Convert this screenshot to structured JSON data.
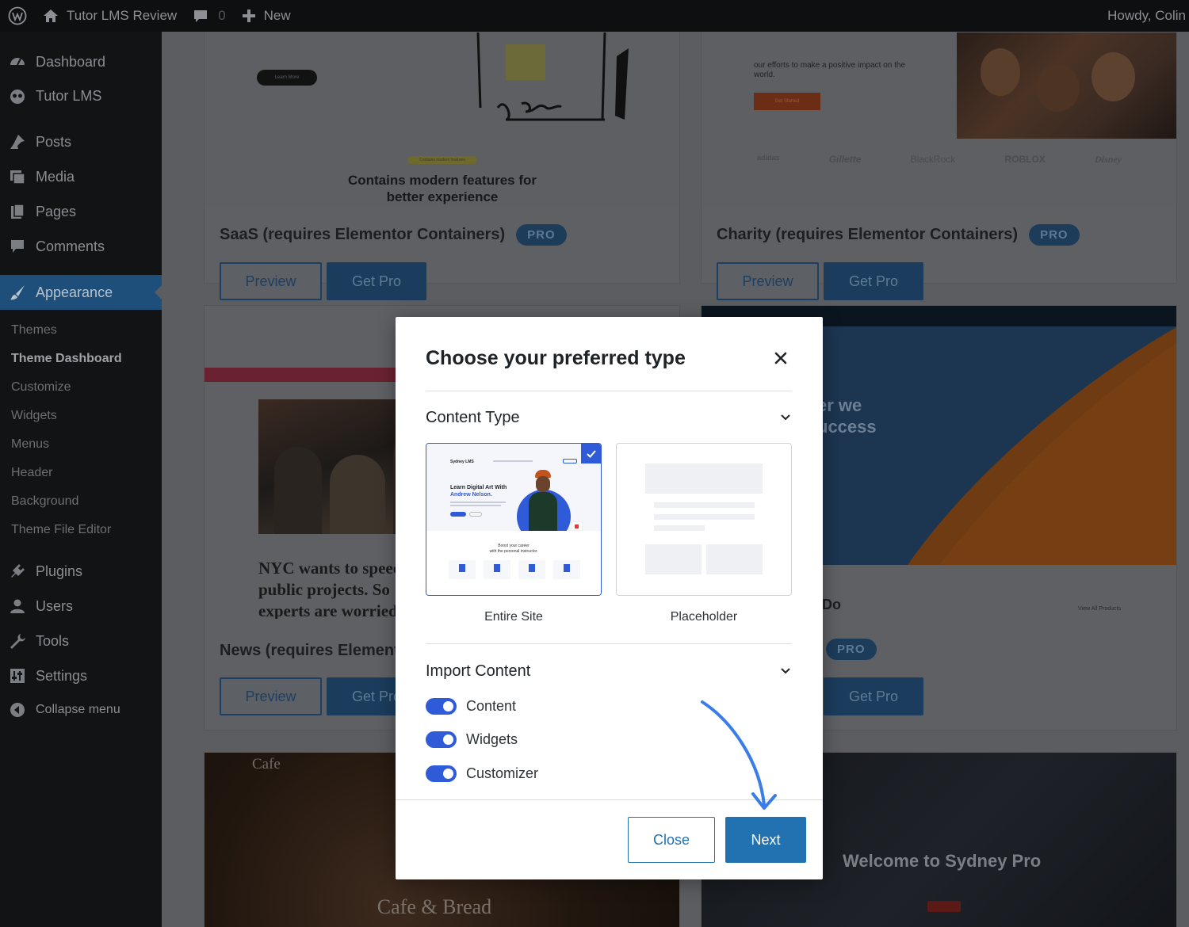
{
  "adminbar": {
    "site_name": "Tutor LMS Review",
    "comment_count": "0",
    "new_label": "New",
    "greeting": "Howdy, Colin",
    "icons": [
      "wordpress-logo-icon",
      "home-icon",
      "comment-icon",
      "plus-icon"
    ]
  },
  "sidebar": {
    "items": [
      {
        "label": "Dashboard",
        "icon": "dashboard-icon"
      },
      {
        "label": "Tutor LMS",
        "icon": "tutor-owl-icon"
      },
      {
        "label": "Posts",
        "icon": "pin-icon"
      },
      {
        "label": "Media",
        "icon": "media-icon"
      },
      {
        "label": "Pages",
        "icon": "pages-icon"
      },
      {
        "label": "Comments",
        "icon": "comment-icon"
      },
      {
        "label": "Appearance",
        "icon": "brush-icon"
      },
      {
        "label": "Plugins",
        "icon": "plugin-icon"
      },
      {
        "label": "Users",
        "icon": "user-icon"
      },
      {
        "label": "Tools",
        "icon": "wrench-icon"
      },
      {
        "label": "Settings",
        "icon": "settings-icon"
      },
      {
        "label": "Collapse menu",
        "icon": "collapse-icon"
      }
    ],
    "appearance_submenu": [
      "Themes",
      "Theme Dashboard",
      "Customize",
      "Widgets",
      "Menus",
      "Header",
      "Background",
      "Theme File Editor"
    ]
  },
  "cards": [
    {
      "title": "SaaS (requires Elementor Containers)",
      "badge": "PRO",
      "preview": "Preview",
      "getpro": "Get Pro",
      "thumb_pill": "Learn More",
      "thumb_tag": "Contains modern features",
      "thumb_heading": "Contains modern features for better experience"
    },
    {
      "title": "Charity (requires Elementor Containers)",
      "badge": "PRO",
      "preview": "Preview",
      "getpro": "Get Pro",
      "thumb_text": "our efforts to make a positive impact on the world.",
      "thumb_btn": "Get Started",
      "logos": [
        "adidas",
        "Gillette",
        "BlackRock",
        "ROBLOX",
        "Disney"
      ]
    },
    {
      "title": "News (requires Elementor Containers)",
      "badge": "PRO",
      "preview": "Preview",
      "getpro": "Get Pro",
      "thumb_headline": "NYC wants to speed public projects. So experts are worried"
    },
    {
      "title": "",
      "badge": "PRO",
      "getpro": "Get Pro",
      "thumb_hero": "er we\nuccess",
      "thumb_do": "Do",
      "thumb_link": "View All Products"
    },
    {
      "thumb_title": "Cafe",
      "thumb_sub": "Cafe & Bread"
    },
    {
      "thumb_title": "Welcome to Sydney Pro"
    }
  ],
  "modal": {
    "title": "Choose your preferred type",
    "content_type_heading": "Content Type",
    "types": [
      {
        "label": "Entire Site",
        "selected": true,
        "preview": {
          "logo": "Sydney LMS",
          "headline1": "Learn Digital Art With",
          "headline2": "Andrew Nelson.",
          "boost1": "Boost your career",
          "boost2": "with the personal instructor."
        }
      },
      {
        "label": "Placeholder",
        "selected": false
      }
    ],
    "import_heading": "Import Content",
    "toggles": [
      {
        "label": "Content",
        "on": true
      },
      {
        "label": "Widgets",
        "on": true
      },
      {
        "label": "Customizer",
        "on": true
      }
    ],
    "close_label": "Close",
    "next_label": "Next",
    "accent": "#2271b1",
    "toggle_color": "#2f5ad8"
  }
}
